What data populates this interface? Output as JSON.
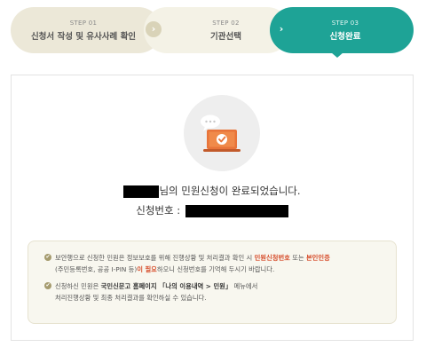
{
  "steps": [
    {
      "num": "STEP 01",
      "label": "신청서 작성 및 유사사례 확인"
    },
    {
      "num": "STEP 02",
      "label": "기관선택"
    },
    {
      "num": "STEP 03",
      "label": "신청완료"
    }
  ],
  "step_arrow": "›",
  "complete": {
    "line1_suffix": "님의 민원신청이 완료되었습니다.",
    "line2_prefix": "신청번호 :"
  },
  "notice": {
    "item1": {
      "t1": "보안행으로 신청한 민원은 정보보호를 위해 진행상황 및 처리결과 확인 시 ",
      "t2": "민원신청번호",
      "t3": " 또는 ",
      "t4": "본인인증",
      "t5": "(주민등록번호, 공공 I-PIN 등)",
      "t6": "이 필요",
      "t7": "하오니 신청번호를 기억해 두시기 바랍니다."
    },
    "item2": {
      "t1": "신청하신 민원은 ",
      "t2": "국민신문고 홈페이지 「나의 이용내역 > 민원」",
      "t3": " 메뉴에서",
      "t4": "처리진행상황 및 최종 처리결과를 확인하실 수 있습니다."
    }
  },
  "icons": {
    "check": "check-circle-icon",
    "illustration": "laptop-check-icon"
  },
  "colors": {
    "accent": "#1ea396",
    "emphasis": "#d64c2a"
  }
}
